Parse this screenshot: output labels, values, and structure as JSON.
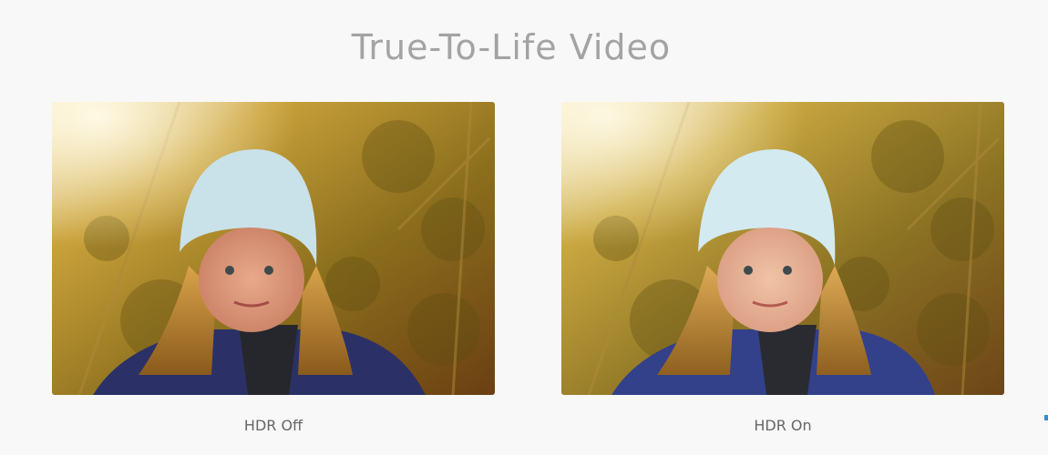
{
  "title": "True-To-Life Video",
  "comparison": {
    "left_label": "HDR Off",
    "right_label": "HDR On"
  },
  "colors": {
    "title": "#a3a3a3",
    "caption": "#666666",
    "background": "#f8f8f8"
  }
}
